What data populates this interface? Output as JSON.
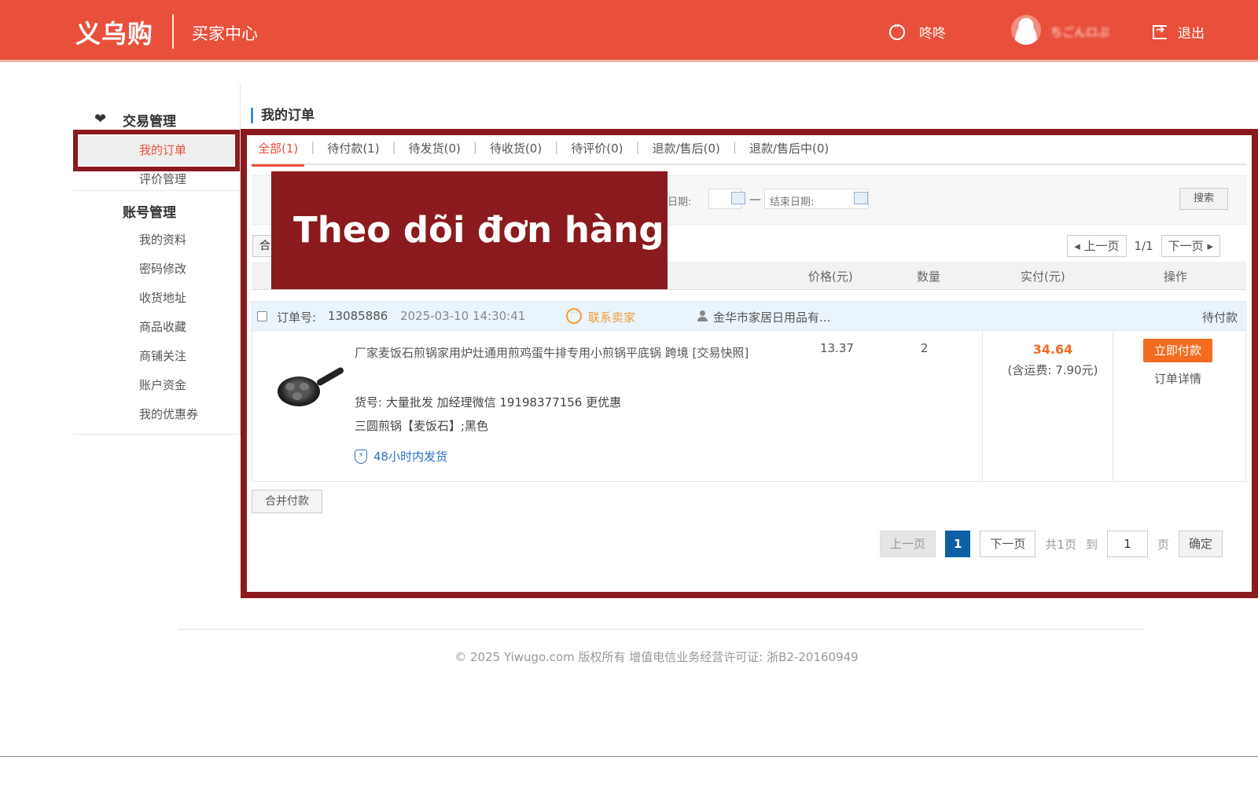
{
  "header": {
    "logo": "义乌购",
    "subtitle": "买家中心",
    "chat_label": "咚咚",
    "username": "ちごんロぷ",
    "logout_label": "退出"
  },
  "sidebar": {
    "groups": [
      {
        "title": "交易管理",
        "items": [
          {
            "label": "我的订单",
            "active": true
          },
          {
            "label": "评价管理"
          }
        ]
      },
      {
        "title": "账号管理",
        "items": [
          {
            "label": "我的资料"
          },
          {
            "label": "密码修改"
          },
          {
            "label": "收货地址"
          },
          {
            "label": "商品收藏"
          },
          {
            "label": "商铺关注"
          },
          {
            "label": "账户资金"
          },
          {
            "label": "我的优惠券"
          }
        ]
      }
    ]
  },
  "main": {
    "title": "我的订单",
    "tabs": [
      "全部(1)",
      "待付款(1)",
      "待发货(0)",
      "待收货(0)",
      "待评价(0)",
      "退款/售后(0)",
      "退款/售后中(0)"
    ],
    "filter": {
      "start_date_label": "日期:",
      "end_date_label": "结束日期:",
      "search_button": "搜索"
    },
    "top_pager": {
      "prev": "上一页",
      "page": "1/1",
      "next": "下一页"
    },
    "merge_top_label": "合",
    "table_headers": {
      "price": "价格(元)",
      "quantity": "数量",
      "paid": "实付(元)",
      "action": "操作"
    },
    "order": {
      "number_label": "订单号:",
      "number": "13085886",
      "time": "2025-03-10 14:30:41",
      "contact_label": "联系卖家",
      "seller": "金华市家居日用品有...",
      "status": "待付款",
      "product_title": "厂家麦饭石煎锅家用炉灶通用煎鸡蛋牛排专用小煎锅平底锅 跨境 [交易快照]",
      "sku_label": "货号: 大量批发 加经理微信 19198377156 更优惠",
      "variant": "三圆煎锅【麦饭石】;黑色",
      "shipping_promise": "48小时内发货",
      "price": "13.37",
      "quantity": "2",
      "paid_amount": "34.64",
      "shipping_fee": "(含运费: 7.90元)",
      "pay_button": "立即付款",
      "detail_link": "订单详情"
    },
    "merge_pay_button": "合并付款",
    "bottom_pager": {
      "prev": "上一页",
      "current": "1",
      "next": "下一页",
      "total": "共1页",
      "goto": "到",
      "page_input": "1",
      "page_unit": "页",
      "confirm": "确定"
    }
  },
  "overlay_banner": "Theo dõi đơn hàng",
  "footer": "© 2025 Yiwugo.com 版权所有 增值电信业务经营许可证: 浙B2-20160949",
  "colors": {
    "header_bg": "#e9503b",
    "highlight_border": "#8b1a1e",
    "accent_orange": "#f36c21",
    "link_blue": "#2f6fc6"
  }
}
